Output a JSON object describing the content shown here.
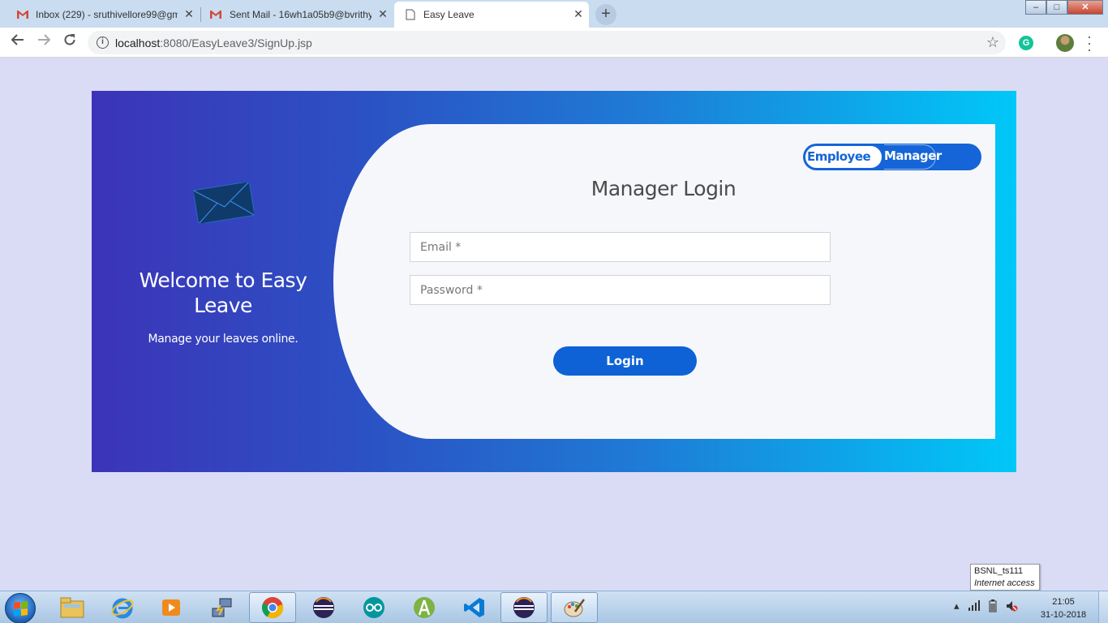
{
  "browser": {
    "tabs": [
      {
        "title": "Inbox (229) - sruthivellore99@gm",
        "icon": "gmail-icon"
      },
      {
        "title": "Sent Mail - 16wh1a05b9@bvrithy",
        "icon": "gmail-icon"
      },
      {
        "title": "Easy Leave",
        "icon": "page-icon",
        "active": true
      }
    ],
    "new_tab": "+",
    "window_controls": {
      "minimize": "–",
      "maximize": "□",
      "close": "✕"
    },
    "url_host": "localhost",
    "url_path": ":8080/EasyLeave3/SignUp.jsp",
    "info_glyph": "i",
    "extension_label": "G"
  },
  "page": {
    "welcome_title": "Welcome to Easy Leave",
    "welcome_subtitle": "Manage your leaves online.",
    "toggle": {
      "employee": "Employee",
      "manager": "Manager"
    },
    "login_title": "Manager Login",
    "email_placeholder": "Email *",
    "password_placeholder": "Password *",
    "login_button": "Login"
  },
  "tooltip": {
    "line1": "BSNL_ts111",
    "line2": "Internet access"
  },
  "taskbar": {
    "time": "21:05",
    "date": "31-10-2018",
    "apps": [
      "file-explorer-icon",
      "internet-explorer-icon",
      "media-player-icon",
      "network-tool-icon",
      "chrome-icon",
      "eclipse-icon",
      "arduino-icon",
      "android-studio-icon",
      "vscode-icon",
      "eclipse-icon",
      "paint-icon"
    ]
  },
  "colors": {
    "accent": "#1565d8",
    "card_gradient_start": "#3c34b8",
    "card_gradient_end": "#00c8f8",
    "page_bg": "#dadcf6"
  }
}
